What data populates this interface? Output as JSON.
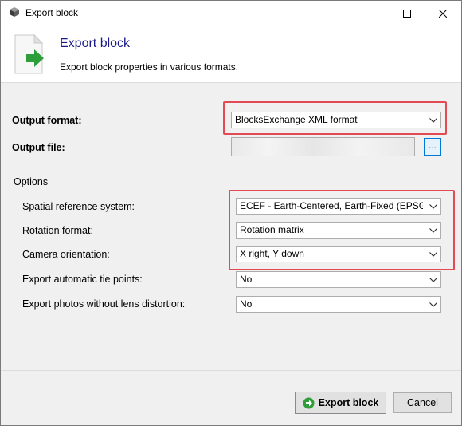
{
  "window": {
    "title": "Export block"
  },
  "header": {
    "title": "Export block",
    "subtitle": "Export block properties in various formats."
  },
  "form": {
    "output_format": {
      "label": "Output format:",
      "value": "BlocksExchange XML format"
    },
    "output_file": {
      "label": "Output file:",
      "value": "",
      "browse_label": "..."
    },
    "options": {
      "legend": "Options",
      "spatial_reference": {
        "label": "Spatial reference system:",
        "value": "ECEF - Earth-Centered, Earth-Fixed (EPSG"
      },
      "rotation_format": {
        "label": "Rotation format:",
        "value": "Rotation matrix"
      },
      "camera_orientation": {
        "label": "Camera orientation:",
        "value": "X right, Y down"
      },
      "tie_points": {
        "label": "Export automatic tie points:",
        "value": "No"
      },
      "photos_no_distortion": {
        "label": "Export photos without lens distortion:",
        "value": "No"
      }
    }
  },
  "buttons": {
    "export_label": "Export block",
    "cancel_label": "Cancel"
  },
  "colors": {
    "highlight": "#e24b53",
    "header_title": "#1a1a8c",
    "browse_border": "#0078d7",
    "go_icon": "#2e9e3a"
  },
  "icons": {
    "title": "block-cube-icon",
    "header": "export-document-icon",
    "export_button": "green-arrow-icon",
    "dropdown": "chevron-down-icon"
  }
}
